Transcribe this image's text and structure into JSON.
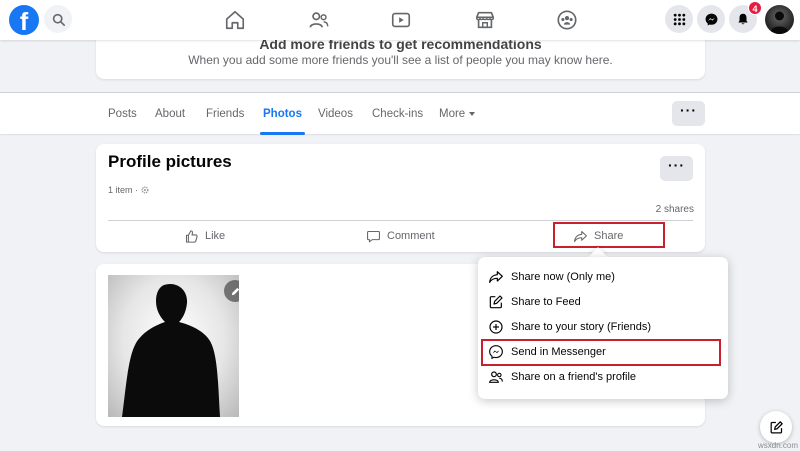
{
  "topbar": {
    "logo_letter": "f",
    "notification_count": "4",
    "nav": [
      "home-icon",
      "friends-icon",
      "watch-icon",
      "marketplace-icon",
      "groups-icon"
    ],
    "right": [
      "menu-grid-icon",
      "messenger-icon",
      "bell-icon"
    ]
  },
  "recommendation": {
    "title": "Add more friends to get recommendations",
    "subtitle": "When you add some more friends you'll see a list of people you may know here."
  },
  "tabs": {
    "items": [
      "Posts",
      "About",
      "Friends",
      "Photos",
      "Videos",
      "Check-ins"
    ],
    "more_label": "More",
    "active": "Photos",
    "more_options_label": "···"
  },
  "album": {
    "title": "Profile pictures",
    "item_count": "1 item ·",
    "shares": "2 shares",
    "options_label": "···",
    "actions": {
      "like": "Like",
      "comment": "Comment",
      "share": "Share"
    }
  },
  "share_menu": {
    "items": [
      {
        "label": "Share now (Only me)",
        "icon": "share-arrow-icon"
      },
      {
        "label": "Share to Feed",
        "icon": "edit-square-icon"
      },
      {
        "label": "Share to your story (Friends)",
        "icon": "plus-circle-icon"
      },
      {
        "label": "Send in Messenger",
        "icon": "messenger-icon"
      },
      {
        "label": "Share on a friend's profile",
        "icon": "people-icon"
      }
    ],
    "highlighted": "Send in Messenger"
  },
  "watermark": "wsxdn.com",
  "colors": {
    "brand": "#1877f2",
    "highlight": "#c8202e",
    "badge": "#e41e3f"
  }
}
